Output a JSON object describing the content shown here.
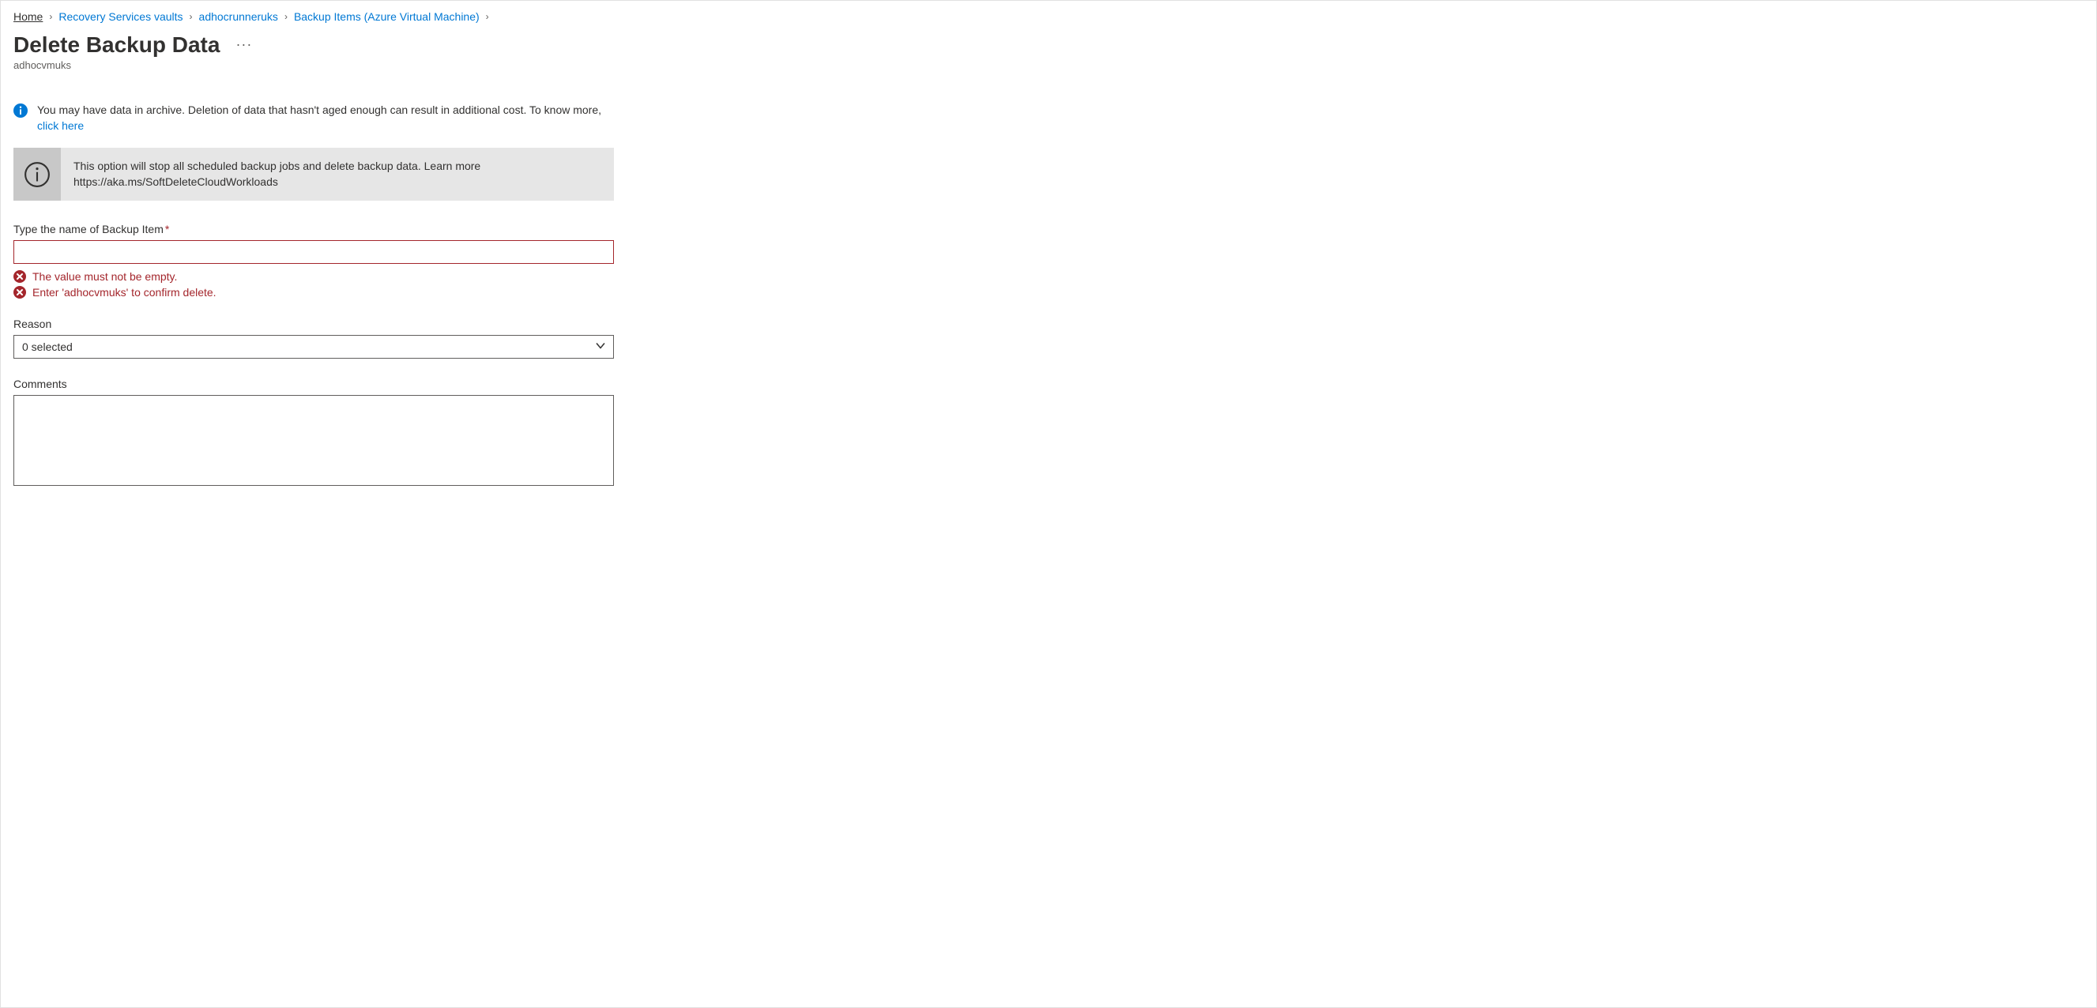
{
  "breadcrumb": {
    "home": "Home",
    "rsv": "Recovery Services vaults",
    "vault": "adhocrunneruks",
    "items": "Backup Items (Azure Virtual Machine)"
  },
  "page": {
    "title": "Delete Backup Data",
    "subtitle": "adhocvmuks"
  },
  "info_banner": {
    "text_part1": "You may have data in archive. Deletion of data that hasn't aged enough can result in additional cost. To know more, ",
    "link": "click here"
  },
  "gray_banner": {
    "line1": "This option will stop all scheduled backup jobs and delete backup data. Learn more",
    "line2": "https://aka.ms/SoftDeleteCloudWorkloads"
  },
  "fields": {
    "name_label": "Type the name of Backup Item",
    "name_value": "",
    "error1": "The value must not be empty.",
    "error2": "Enter 'adhocvmuks' to confirm delete.",
    "reason_label": "Reason",
    "reason_selected": "0 selected",
    "comments_label": "Comments",
    "comments_value": ""
  }
}
